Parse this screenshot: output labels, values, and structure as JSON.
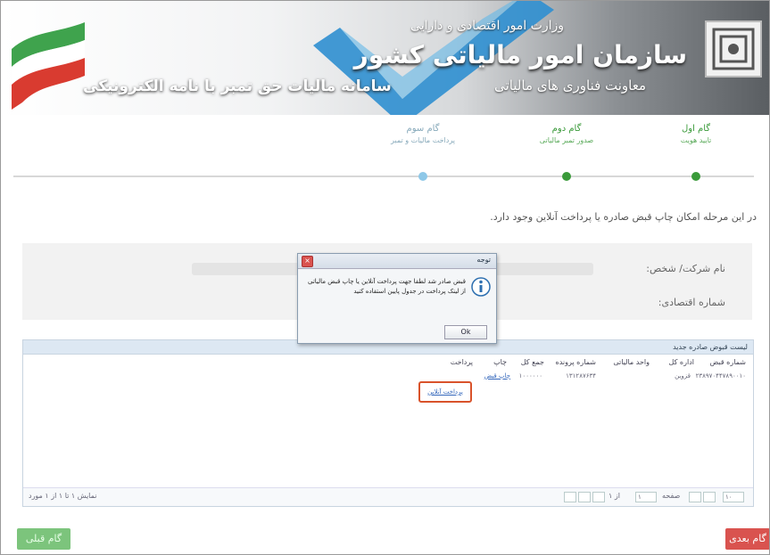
{
  "header": {
    "ministry": "وزارت امور اقتصادی و دارایی",
    "organization": "سازمان امور مالیاتی کشور",
    "deputy": "معاونت فناوری های مالیاتی",
    "system": "سامانه مالیات حق تمبر با نامه الکترونیکی"
  },
  "stepper": {
    "steps": [
      {
        "title": "گام اول",
        "subtitle": "تایید هویت"
      },
      {
        "title": "گام دوم",
        "subtitle": "صدور تمبر مالیاتی"
      },
      {
        "title": "گام سوم",
        "subtitle": "پرداخت مالیات و تمبر"
      }
    ]
  },
  "info_text": "در این مرحله امکان چاپ قبض صادره یا پرداخت آنلاین وجود دارد.",
  "form": {
    "name_label": "نام شرکت/ شخص:",
    "economic_code_label": "شماره اقتصادی:"
  },
  "receipts": {
    "title": "لیست قبوض صادره جدید",
    "columns": [
      "شماره قبض",
      "اداره کل",
      "واحد مالیاتی",
      "شماره پرونده",
      "جمع کل",
      "چاپ",
      "پرداخت"
    ],
    "row": {
      "receipt_no": "۲۳۸۹۷۰۴۴۷۸۹۰۰۱۰",
      "office": "قزوین",
      "file_no": "۱۳۱۲۸۷۶۳۴",
      "amount": "۱۰۰۰۰۰۰",
      "print": "چاپ قبض",
      "pay": "پرداخت آنلاین"
    },
    "pager": {
      "page_label": "صفحه",
      "page_value": "۱",
      "of_label": "از ۱",
      "page_size": "۱۰",
      "summary": "نمایش ۱ تا ۱ از ۱ مورد"
    }
  },
  "dialog": {
    "title": "توجه",
    "message": "قبض صادر شد لطفا جهت پرداخت آنلاین یا چاپ قبض مالیاتی از لینک پرداخت در جدول پایین استفاده کنید",
    "ok": "Ok"
  },
  "buttons": {
    "prev": "گام قبلی",
    "next": "گام بعدی"
  }
}
